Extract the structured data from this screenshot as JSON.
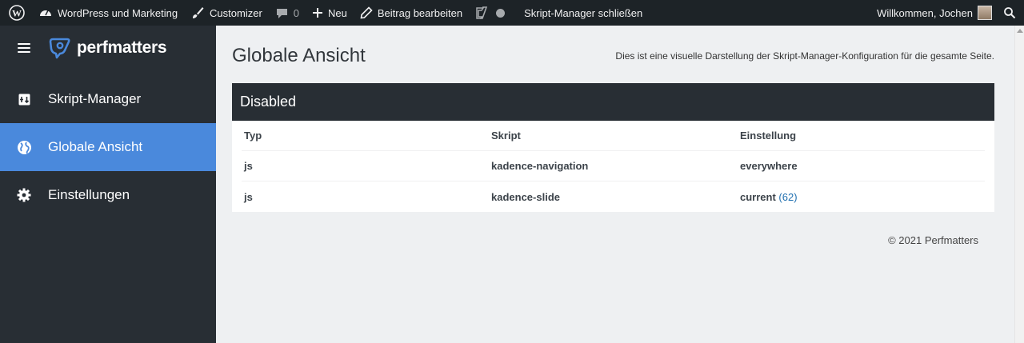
{
  "adminbar": {
    "site_name": "WordPress und Marketing",
    "customizer": "Customizer",
    "comments_count": "0",
    "new_label": "Neu",
    "edit_post": "Beitrag bearbeiten",
    "close_manager": "Skript-Manager schließen",
    "greeting": "Willkommen, Jochen"
  },
  "sidebar": {
    "logo": "perfmatters",
    "items": [
      {
        "label": "Skript-Manager",
        "icon": "script-manager-icon"
      },
      {
        "label": "Globale Ansicht",
        "icon": "globe-icon",
        "active": true
      },
      {
        "label": "Einstellungen",
        "icon": "gear-icon"
      }
    ]
  },
  "main": {
    "title": "Globale Ansicht",
    "description": "Dies ist eine visuelle Darstellung der Skript-Manager-Konfiguration für die gesamte Seite.",
    "panel_title": "Disabled",
    "table": {
      "headers": [
        "Typ",
        "Skript",
        "Einstellung"
      ],
      "rows": [
        {
          "type": "js",
          "script": "kadence-navigation",
          "setting": "everywhere",
          "link": ""
        },
        {
          "type": "js",
          "script": "kadence-slide",
          "setting": "current",
          "link": "(62)"
        }
      ]
    },
    "footer": "© 2021 Perfmatters"
  },
  "colors": {
    "adminbar": "#1d2327",
    "sidebar": "#282e34",
    "active_accent": "#4a89dc",
    "link": "#2271b1"
  }
}
